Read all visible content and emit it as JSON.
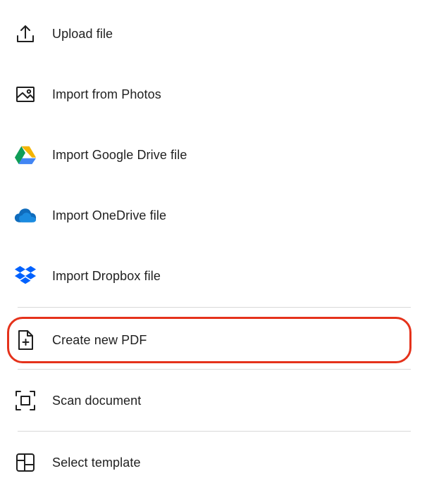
{
  "menu": {
    "items": [
      {
        "label": "Upload file",
        "icon": "upload-icon"
      },
      {
        "label": "Import from Photos",
        "icon": "photo-icon"
      },
      {
        "label": "Import Google Drive file",
        "icon": "google-drive-icon"
      },
      {
        "label": "Import OneDrive file",
        "icon": "onedrive-icon"
      },
      {
        "label": "Import Dropbox file",
        "icon": "dropbox-icon"
      },
      {
        "label": "Create new PDF",
        "icon": "new-file-icon"
      },
      {
        "label": "Scan document",
        "icon": "scan-icon"
      },
      {
        "label": "Select template",
        "icon": "template-icon"
      }
    ]
  },
  "colors": {
    "highlight": "#e5321b",
    "divider": "#d8d8d8",
    "text": "#1f1f1f",
    "drive_green": "#0f9d58",
    "drive_yellow": "#f4b400",
    "drive_blue": "#4285f4",
    "onedrive_blue": "#0f6cbd",
    "dropbox_blue": "#0061fe"
  },
  "highlighted_item": "Create new PDF"
}
